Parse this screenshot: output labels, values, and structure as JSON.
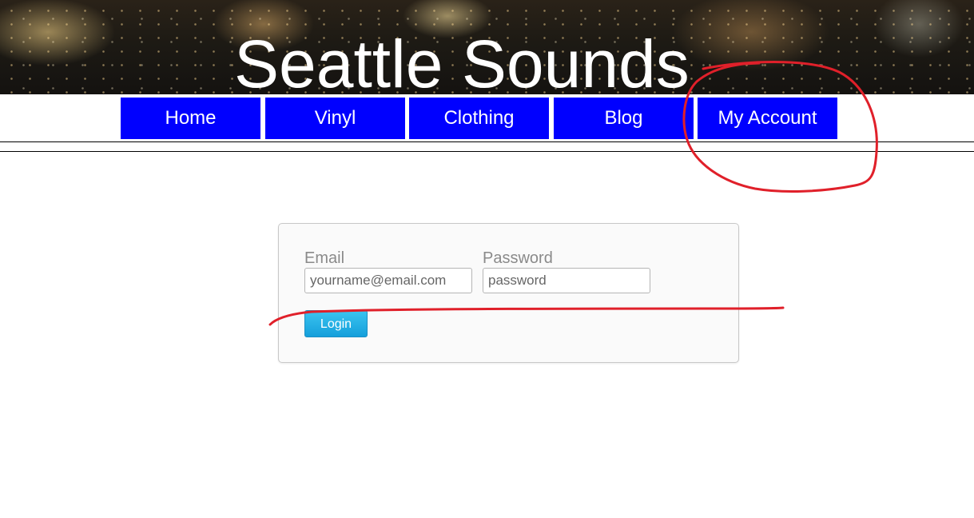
{
  "site": {
    "title": "Seattle Sounds"
  },
  "nav": {
    "items": [
      {
        "label": "Home"
      },
      {
        "label": "Vinyl"
      },
      {
        "label": "Clothing"
      },
      {
        "label": "Blog"
      },
      {
        "label": "My Account"
      }
    ],
    "color": "#0000ff"
  },
  "login": {
    "email": {
      "label": "Email",
      "placeholder": "yourname@email.com",
      "value": ""
    },
    "password": {
      "label": "Password",
      "placeholder": "password",
      "value": ""
    },
    "submit_label": "Login"
  },
  "annotations": {
    "color": "#e0202a",
    "marks": [
      "circle-around-my-account",
      "underline-through-login-form"
    ]
  }
}
